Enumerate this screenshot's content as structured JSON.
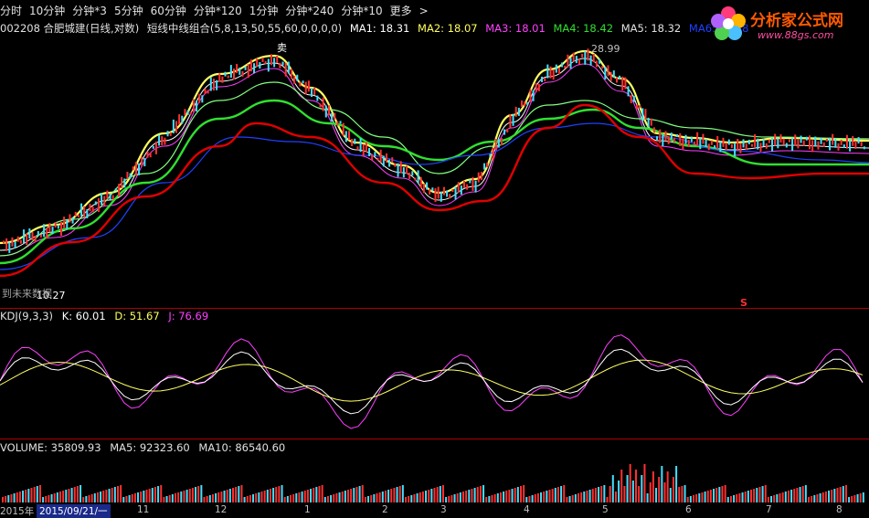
{
  "toolbar": {
    "items": [
      "分时",
      "10分钟",
      "分钟*3",
      "5分钟",
      "60分钟",
      "分钟*120",
      "1分钟",
      "分钟*240",
      "分钟*10",
      "更多"
    ],
    "more_arrow": ">"
  },
  "info": {
    "code_name": "002208 合肥城建(日线,对数)",
    "indicator": "短线中线组合(5,8,13,50,55,60,0,0,0,0)",
    "ma1": "MA1: 18.31",
    "ma2": "MA2: 18.07",
    "ma3": "MA3: 18.01",
    "ma4": "MA4: 18.42",
    "ma5": "MA5: 18.32",
    "ma6": "MA6: 18.38"
  },
  "logo": {
    "brand": "分析家公式网",
    "url": "www.88gs.com"
  },
  "annotations": {
    "sell": "卖",
    "high_price": "28.99",
    "low_price": "10.27",
    "future_data": "到未来数据",
    "s_marker": "S"
  },
  "kdj": {
    "name": "KDJ(9,3,3)",
    "k": "K: 60.01",
    "d": "D: 51.67",
    "j": "J: 76.69"
  },
  "volume": {
    "name": "VOLUME: 35809.93",
    "ma5": "MA5: 92323.60",
    "ma10": "MA10: 86540.60"
  },
  "time_axis": {
    "year": "2015年",
    "cursor_date": "2015/09/21/一",
    "months": [
      "11",
      "12",
      "1",
      "2",
      "3",
      "4",
      "5",
      "6",
      "7",
      "8"
    ]
  },
  "colors": {
    "up": "#ff3030",
    "down": "#40e0ff",
    "ma_white": "#ffffff",
    "ma_yellow": "#ffff60",
    "ma_magenta": "#ff40ff",
    "ma_green": "#30e030",
    "ma_lightgreen": "#80ff80",
    "ma_blue": "#2040ff",
    "ma_red": "#e00000"
  }
}
